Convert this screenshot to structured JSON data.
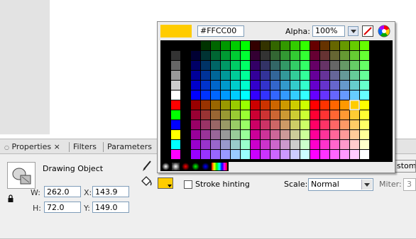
{
  "panel": {
    "tabs": [
      {
        "label": "Properties ×"
      },
      {
        "label": "Filters"
      },
      {
        "label": "Parameters"
      }
    ],
    "object_label": "Drawing Object",
    "w_label": "W:",
    "w_value": "262.0",
    "x_label": "X:",
    "x_value": "143.9",
    "h_label": "H:",
    "h_value": "72.0",
    "y_label": "Y:",
    "y_value": "149.0",
    "stroke_hinting_label": "Stroke hinting",
    "scale_label": "Scale:",
    "scale_value": "Normal",
    "miter_label": "Miter:",
    "miter_value": "3",
    "custom_button": "stom"
  },
  "color_popup": {
    "current_hex": "#FFCC00",
    "alpha_label": "Alpha:",
    "alpha_value": "100%",
    "selected_color": "#FFCC00",
    "left_column_colors": [
      "#000000",
      "#333333",
      "#666666",
      "#999999",
      "#cccccc",
      "#ffffff",
      "#ff0000",
      "#00ff00",
      "#0000ff",
      "#ffff00",
      "#00ffff",
      "#ff00ff"
    ],
    "gradient_swatches": [
      "black-white-radial",
      "black-white-radial",
      "red-radial",
      "green-radial",
      "blue-radial",
      "rainbow-linear"
    ],
    "icons": [
      "dropdown-icon",
      "no-color-icon",
      "color-wheel-icon"
    ]
  },
  "icons": [
    "pencil-icon",
    "paint-bucket-icon",
    "lock-icon",
    "drawing-object-icon"
  ]
}
